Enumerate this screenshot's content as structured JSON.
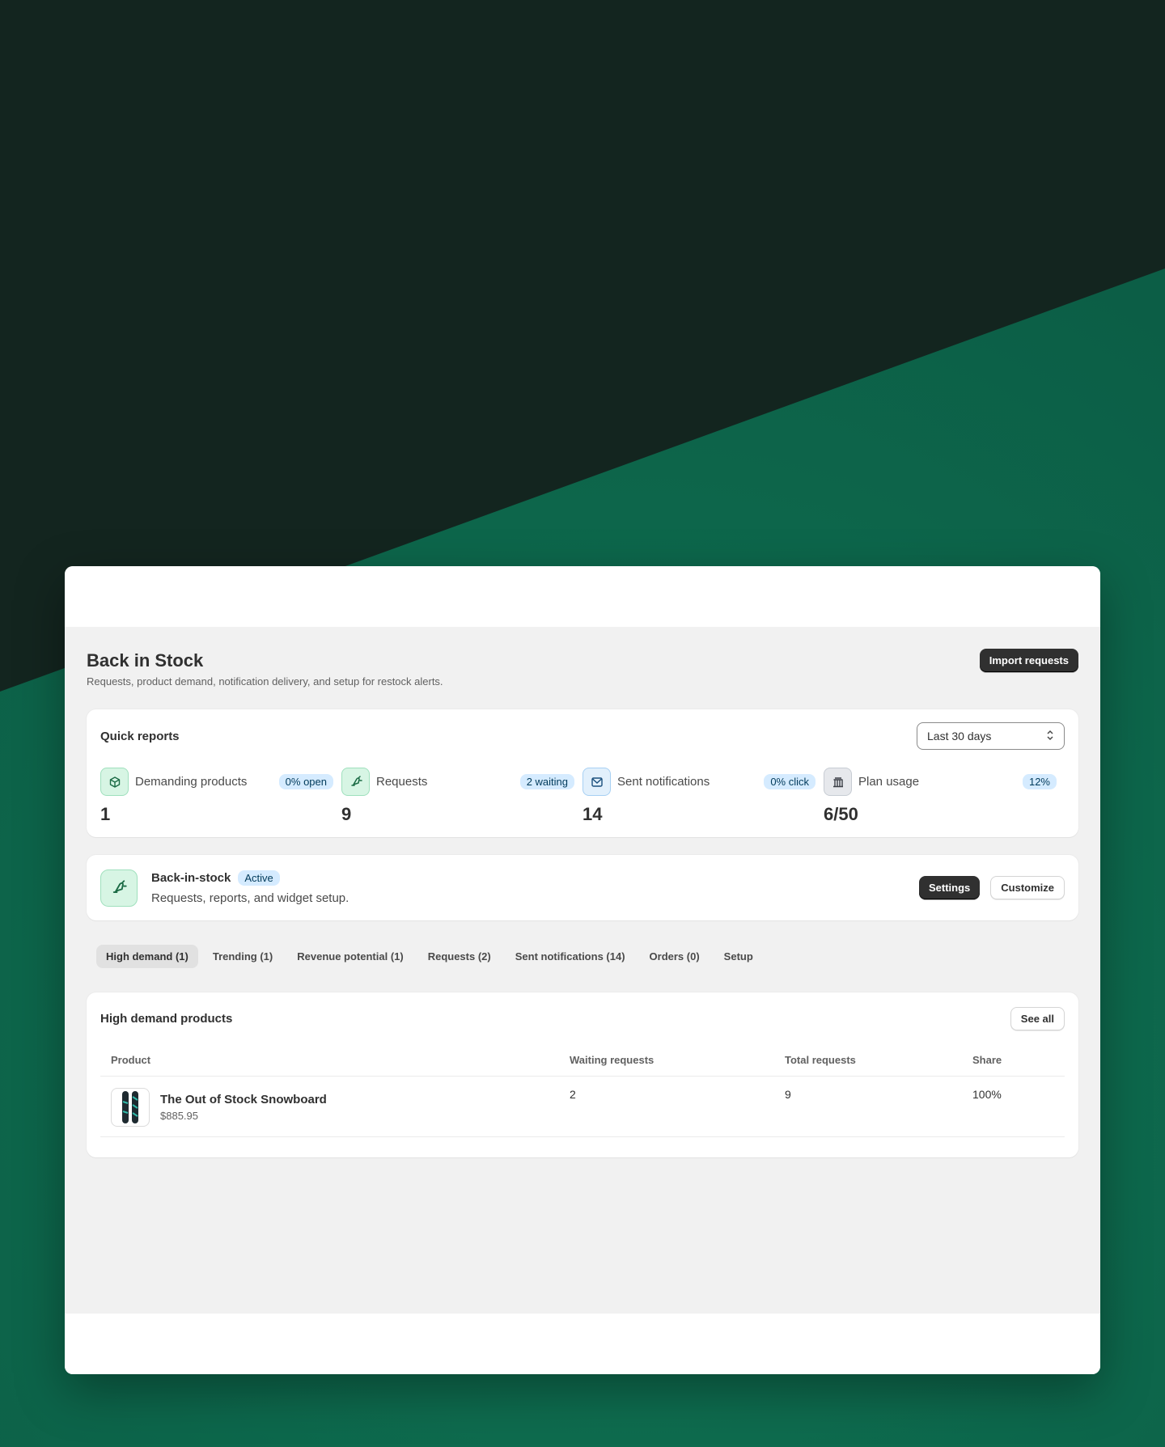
{
  "page": {
    "title": "Back in Stock",
    "subtitle": "Requests, product demand, notification delivery, and setup for restock alerts.",
    "import_button": "Import requests"
  },
  "quick_reports": {
    "title": "Quick reports",
    "range_select": "Last 30 days",
    "metrics": [
      {
        "label": "Demanding products",
        "badge": "0% open",
        "value": "1",
        "icon": "package-icon"
      },
      {
        "label": "Requests",
        "badge": "2 waiting",
        "value": "9",
        "icon": "bell-ring-icon"
      },
      {
        "label": "Sent notifications",
        "badge": "0% click",
        "value": "14",
        "icon": "envelope-icon"
      },
      {
        "label": "Plan usage",
        "badge": "12%",
        "value": "6/50",
        "icon": "bank-icon"
      }
    ]
  },
  "widget": {
    "name": "Back-in-stock",
    "status": "Active",
    "description": "Requests, reports, and widget setup.",
    "settings_button": "Settings",
    "customize_button": "Customize"
  },
  "tabs": [
    {
      "label": "High demand (1)",
      "active": true
    },
    {
      "label": "Trending (1)"
    },
    {
      "label": "Revenue potential (1)"
    },
    {
      "label": "Requests (2)"
    },
    {
      "label": "Sent notifications (14)"
    },
    {
      "label": "Orders (0)"
    },
    {
      "label": "Setup"
    }
  ],
  "high_demand": {
    "title": "High demand products",
    "see_all": "See all",
    "columns": [
      "Product",
      "Waiting requests",
      "Total requests",
      "Share"
    ],
    "rows": [
      {
        "name": "The Out of Stock Snowboard",
        "price": "$885.95",
        "waiting": "2",
        "total": "9",
        "share": "100%"
      }
    ]
  },
  "colors": {
    "background_dark": "#13251f",
    "background_green": "#0e6b50",
    "primary_button": "#303030",
    "badge_info": "#d5ebff"
  }
}
